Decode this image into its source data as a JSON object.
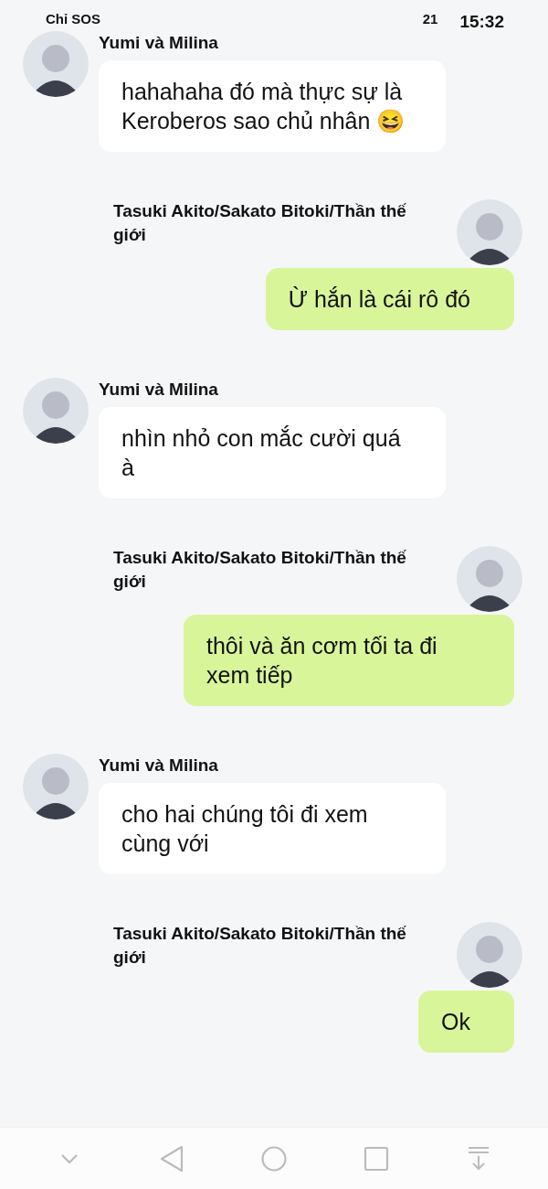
{
  "status_bar": {
    "carrier": "Chỉ SOS",
    "battery": "21",
    "time": "15:32"
  },
  "messages": [
    {
      "kind": "received",
      "sender": "Yumi và Milina",
      "text": "hahahaha đó mà thực sự là Keroberos sao chủ nhân 😆"
    },
    {
      "kind": "sent",
      "sender": "Tasuki Akito/Sakato Bitoki/Thần thế giới",
      "text": "Ừ hắn là cái rô đó"
    },
    {
      "kind": "received",
      "sender": "Yumi và Milina",
      "text": "nhìn nhỏ con mắc cười quá à"
    },
    {
      "kind": "sent",
      "sender": "Tasuki Akito/Sakato Bitoki/Thần thế giới",
      "text": "thôi và ăn cơm tối ta đi xem tiếp"
    },
    {
      "kind": "received",
      "sender": "Yumi và Milina",
      "text": "cho hai chúng tôi đi xem cùng với"
    },
    {
      "kind": "sent",
      "sender": "Tasuki Akito/Sakato Bitoki/Thần thế giới",
      "text": "Ok"
    }
  ]
}
